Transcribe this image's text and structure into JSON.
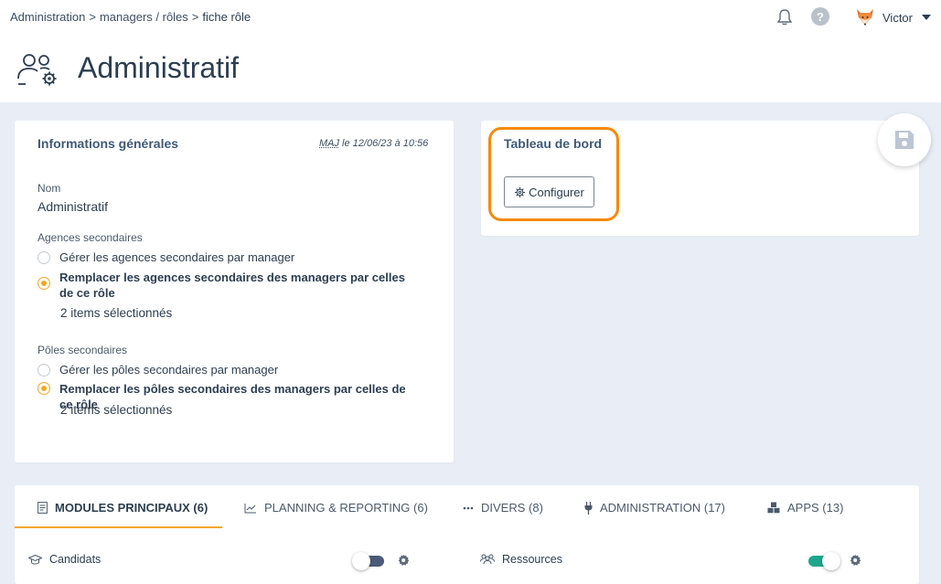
{
  "breadcrumb": {
    "items": [
      "Administration",
      "managers / rôles",
      "fiche rôle"
    ],
    "separator": ">"
  },
  "header": {
    "user_name": "Victor",
    "page_title": "Administratif",
    "help_glyph": "?"
  },
  "info_card": {
    "title": "Informations générales",
    "maj_abbr": "MAJ",
    "maj_text": " le 12/06/23 à 10:56",
    "nom_label": "Nom",
    "nom_value": "Administratif",
    "agences_label": "Agences secondaires",
    "agences_opt1": "Gérer les agences secondaires par manager",
    "agences_opt2": "Remplacer les agences secondaires des managers par celles de ce rôle",
    "agences_items": "2 items sélectionnés",
    "poles_label": "Pôles secondaires",
    "poles_opt1": "Gérer les pôles secondaires par manager",
    "poles_opt2": "Remplacer les pôles secondaires des managers par celles de ce rôle",
    "poles_items": "2 items sélectionnés"
  },
  "dashboard_card": {
    "title": "Tableau de bord",
    "configure_label": "Configurer"
  },
  "tabs": [
    {
      "label": "MODULES PRINCIPAUX (6)",
      "icon": "document-icon",
      "active": true
    },
    {
      "label": "PLANNING & REPORTING (6)",
      "icon": "chart-line-icon",
      "active": false
    },
    {
      "label": "DIVERS (8)",
      "icon": "dots-icon",
      "active": false
    },
    {
      "label": "ADMINISTRATION (17)",
      "icon": "plug-icon",
      "active": false
    },
    {
      "label": "APPS (13)",
      "icon": "cubes-icon",
      "active": false
    }
  ],
  "modules": [
    {
      "label": "Candidats",
      "icon": "graduation-cap-icon",
      "enabled": false
    },
    {
      "label": "Ressources",
      "icon": "users-icon",
      "enabled": true
    }
  ],
  "colors": {
    "accent": "#f5a623",
    "highlight": "#f58a0b",
    "toggle_on": "#1fa68a",
    "toggle_off": "#4a5a78",
    "background": "#e9eef6"
  }
}
